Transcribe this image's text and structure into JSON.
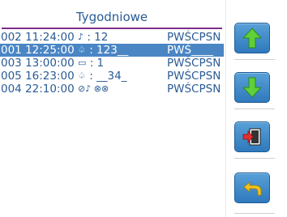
{
  "title": "Tygodniowe",
  "rows": [
    {
      "id": "002",
      "time": "11:24:00",
      "icon": "music-note-icon",
      "glyph": "♪",
      "value": ": 12",
      "days": "PWŚCPSN",
      "selected": false
    },
    {
      "id": "001",
      "time": "12:25:00",
      "icon": "bell-icon",
      "glyph": "♤",
      "value": ": 123__",
      "days": "PWŚ____",
      "selected": true
    },
    {
      "id": "003",
      "time": "13:00:00",
      "icon": "display-icon",
      "glyph": "▭",
      "value": ": 1",
      "days": "PWŚCPSN",
      "selected": false
    },
    {
      "id": "005",
      "time": "16:23:00",
      "icon": "bell-icon",
      "glyph": "♤",
      "value": ": __34_",
      "days": "PWŚCPSN",
      "selected": false
    },
    {
      "id": "004",
      "time": "22:10:00",
      "icon": "muted-icons",
      "glyph": "⊘♪ ⊗⊗",
      "value": "",
      "days": "PWŚCPSN",
      "selected": false
    }
  ],
  "buttons": [
    {
      "name": "move-up-button",
      "icon": "arrow-up-icon",
      "color": "#5fcf3a"
    },
    {
      "name": "move-down-button",
      "icon": "arrow-down-icon",
      "color": "#5fcf3a"
    },
    {
      "name": "exit-button",
      "icon": "door-exit-icon",
      "color": "#e03030"
    },
    {
      "name": "back-button",
      "icon": "return-arrow-icon",
      "color": "#f2c21a"
    }
  ]
}
